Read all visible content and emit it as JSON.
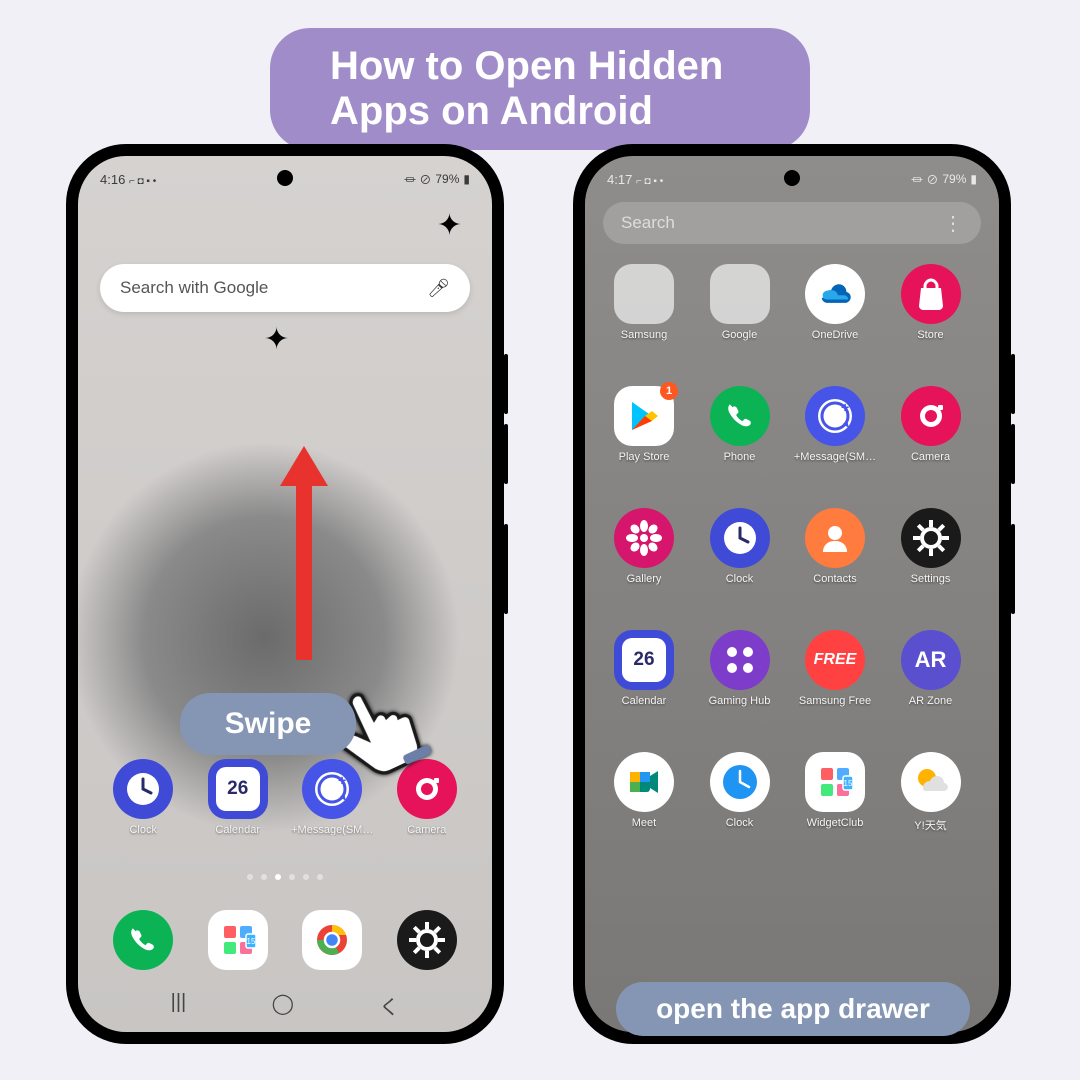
{
  "title": "How to Open Hidden Apps on Android",
  "callouts": {
    "swipe": "Swipe",
    "drawer": "open the app drawer"
  },
  "status": {
    "left_time": "4:16",
    "right_time": "4:17",
    "battery": "79%",
    "icons": "⌐ ◘ ▪ •",
    "right_icons": "⏛ ⊘"
  },
  "search": {
    "placeholder": "Search with Google",
    "drawer_placeholder": "Search"
  },
  "home": {
    "row": [
      {
        "label": "Clock",
        "bg": "#3f4bd6",
        "face": "#fff",
        "type": "clock"
      },
      {
        "label": "Calendar",
        "bg": "#3f4bd6",
        "txt": "26",
        "type": "cal"
      },
      {
        "label": "+Message(SM…",
        "bg": "#4654e8",
        "type": "msg"
      },
      {
        "label": "Camera",
        "bg": "#e6135a",
        "type": "cam"
      }
    ],
    "fav": [
      {
        "bg": "#0cb355",
        "type": "phone"
      },
      {
        "bg": "#fff",
        "type": "widget"
      },
      {
        "bg": "#fff",
        "type": "chrome"
      },
      {
        "bg": "#1a1a1a",
        "type": "gear"
      }
    ]
  },
  "drawer": [
    {
      "label": "Samsung",
      "type": "folder",
      "colors": [
        "#f7b731",
        "#7d5fff",
        "#e8322d",
        "#2d98da",
        "#ff6348",
        "#1e90ff"
      ]
    },
    {
      "label": "Google",
      "type": "folder",
      "colors": [
        "#4285f4",
        "#ea4335",
        "#fbbc05",
        "#34a853",
        "#ff0000",
        "#ea4335"
      ]
    },
    {
      "label": "OneDrive",
      "bg": "#fff",
      "type": "onedrive"
    },
    {
      "label": "Store",
      "bg": "#e6135a",
      "type": "store"
    },
    {
      "label": "Play Store",
      "bg": "#fff",
      "type": "play",
      "badge": "1"
    },
    {
      "label": "Phone",
      "bg": "#0cb355",
      "type": "phone"
    },
    {
      "label": "+Message(SM…",
      "bg": "#4654e8",
      "type": "msg"
    },
    {
      "label": "Camera",
      "bg": "#e6135a",
      "type": "cam"
    },
    {
      "label": "Gallery",
      "bg": "#d6156c",
      "type": "gallery"
    },
    {
      "label": "Clock",
      "bg": "#3f4bd6",
      "type": "clock"
    },
    {
      "label": "Contacts",
      "bg": "#ff7b3e",
      "type": "contact"
    },
    {
      "label": "Settings",
      "bg": "#1a1a1a",
      "type": "gear"
    },
    {
      "label": "Calendar",
      "bg": "#3f4bd6",
      "txt": "26",
      "type": "cal"
    },
    {
      "label": "Gaming Hub",
      "bg": "#7d3cc9",
      "type": "gaming"
    },
    {
      "label": "Samsung Free",
      "bg": "#ff4141",
      "txt": "FREE",
      "type": "free"
    },
    {
      "label": "AR Zone",
      "bg": "#5a4fcf",
      "txt": "AR",
      "type": "ar"
    },
    {
      "label": "Meet",
      "bg": "#fff",
      "type": "meet"
    },
    {
      "label": "Clock",
      "bg": "#fff",
      "type": "clock2"
    },
    {
      "label": "WidgetClub",
      "bg": "#fff",
      "type": "widget"
    },
    {
      "label": "Y!天気",
      "bg": "#fff",
      "type": "weather"
    }
  ]
}
